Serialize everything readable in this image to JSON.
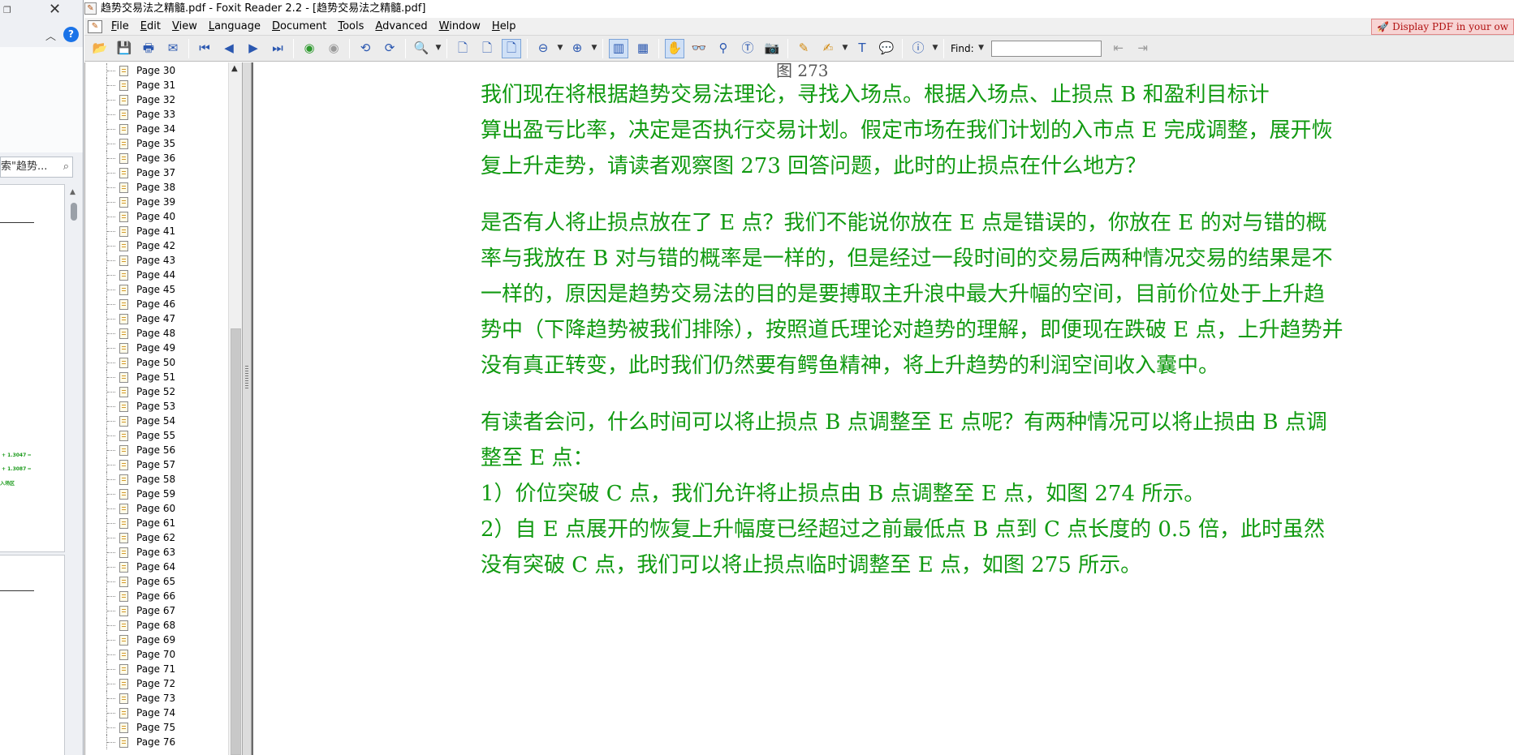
{
  "background_window": {
    "search_text": "索\"趋势..."
  },
  "window": {
    "title": "趋势交易法之精髓.pdf - Foxit Reader 2.2 - [趋势交易法之精髓.pdf]"
  },
  "menu": {
    "items": [
      "File",
      "Edit",
      "View",
      "Language",
      "Document",
      "Tools",
      "Advanced",
      "Window",
      "Help"
    ],
    "mnemonics": [
      "F",
      "E",
      "V",
      "L",
      "D",
      "T",
      "A",
      "W",
      "H"
    ],
    "ad_text": "Display PDF in your ow"
  },
  "toolbar": {
    "find_label": "Find:",
    "find_value": ""
  },
  "bookmarks": {
    "items": [
      "Page 30",
      "Page 31",
      "Page 32",
      "Page 33",
      "Page 34",
      "Page 35",
      "Page 36",
      "Page 37",
      "Page 38",
      "Page 39",
      "Page 40",
      "Page 41",
      "Page 42",
      "Page 43",
      "Page 44",
      "Page 45",
      "Page 46",
      "Page 47",
      "Page 48",
      "Page 49",
      "Page 50",
      "Page 51",
      "Page 52",
      "Page 53",
      "Page 54",
      "Page 55",
      "Page 56",
      "Page 57",
      "Page 58",
      "Page 59",
      "Page 60",
      "Page 61",
      "Page 62",
      "Page 63",
      "Page 64",
      "Page 65",
      "Page 66",
      "Page 67",
      "Page 68",
      "Page 69",
      "Page 70",
      "Page 71",
      "Page 72",
      "Page 73",
      "Page 74",
      "Page 75",
      "Page 76"
    ]
  },
  "document": {
    "figure_caption": "图 273",
    "lines": [
      "我们现在将根据趋势交易法理论，寻找入场点。根据入场点、止损点 B 和盈利目标计",
      "算出盈亏比率，决定是否执行交易计划。假定市场在我们计划的入市点 E 完成调整，展开恢",
      "复上升走势，请读者观察图 273 回答问题，此时的止损点在什么地方？",
      "是否有人将止损点放在了 E 点？我们不能说你放在 E 点是错误的，你放在 E 的对与错的概",
      "率与我放在 B 对与错的概率是一样的，但是经过一段时间的交易后两种情况交易的结果是不",
      "一样的，原因是趋势交易法的目的是要搏取主升浪中最大升幅的空间，目前价位处于上升趋",
      "势中（下降趋势被我们排除），按照道氏理论对趋势的理解，即便现在跌破 E 点，上升趋势并",
      "没有真正转变，此时我们仍然要有鳄鱼精神，将上升趋势的利润空间收入囊中。",
      "有读者会问，什么时间可以将止损点 B 点调整至 E 点呢？有两种情况可以将止损由 B 点调",
      "整至 E 点：",
      "1）价位突破 C 点，我们允许将止损点由 B 点调整至 E 点，如图 274 所示。",
      "2）自 E 点展开的恢复上升幅度已经超过之前最低点 B 点到 C 点长度的 0.5 倍，此时虽然",
      "没有突破 C 点，我们可以将止损点临时调整至 E 点，如图 275 所示。"
    ]
  }
}
